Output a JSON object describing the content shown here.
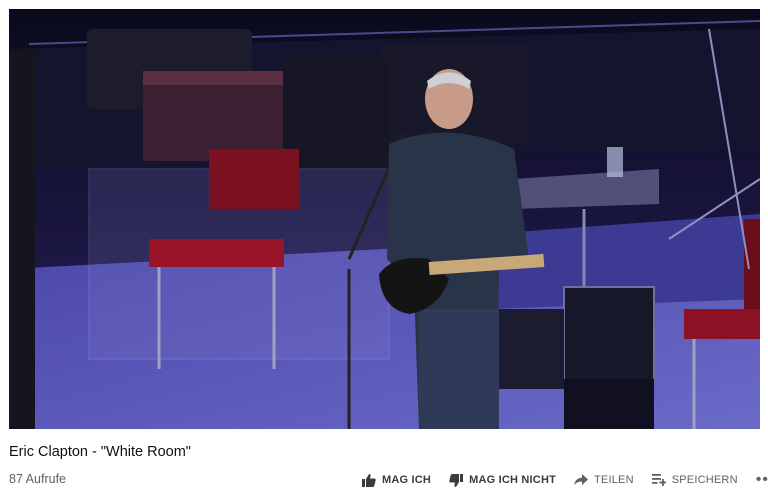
{
  "video": {
    "title": "Eric Clapton - \"White Room\"",
    "views": "87 Aufrufe"
  },
  "actions": {
    "like_label": "MAG ICH",
    "dislike_label": "MAG ICH NICHT",
    "share_label": "TEILEN",
    "save_label": "SPEICHERN",
    "more_label": "•••"
  },
  "icons": {
    "like": "thumbs-up-icon",
    "dislike": "thumbs-down-icon",
    "share": "share-arrow-icon",
    "save": "playlist-add-icon"
  }
}
